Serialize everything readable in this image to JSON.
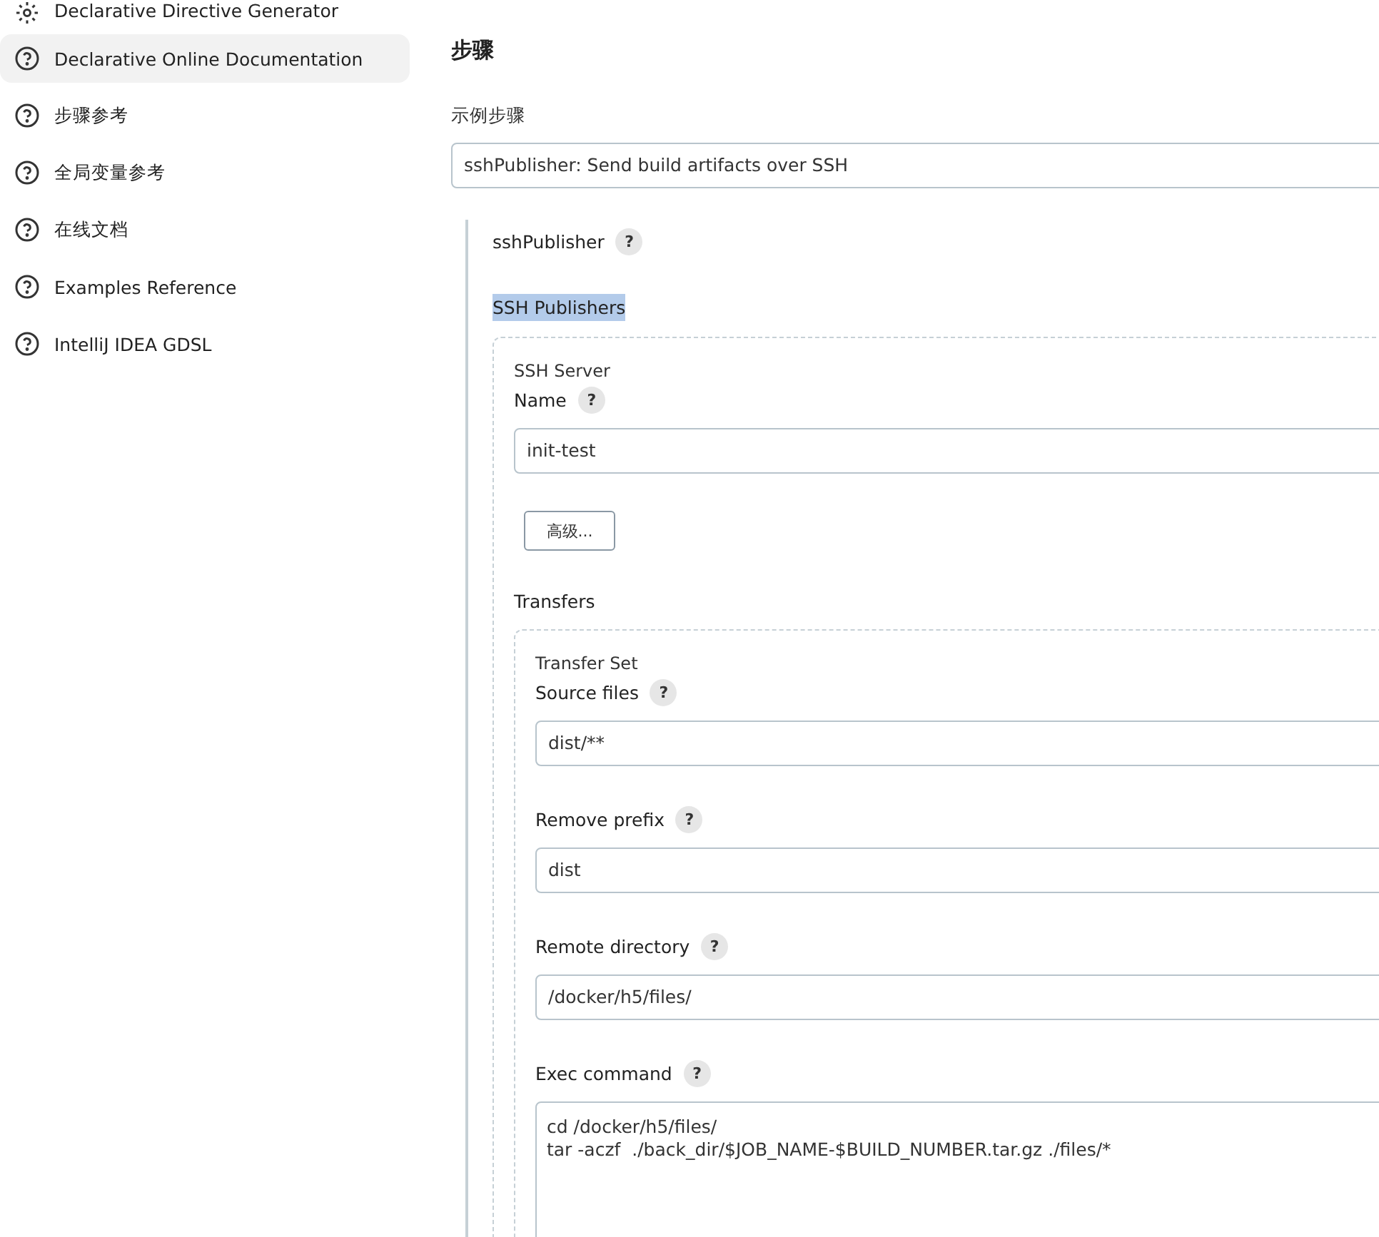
{
  "sidebar": {
    "items": [
      {
        "label": "Declarative Directive Generator",
        "kind": "gear",
        "selected": false
      },
      {
        "label": "Declarative Online Documentation",
        "kind": "help",
        "selected": true
      },
      {
        "label": "步骤参考",
        "kind": "help",
        "selected": false
      },
      {
        "label": "全局变量参考",
        "kind": "help",
        "selected": false
      },
      {
        "label": "在线文档",
        "kind": "help",
        "selected": false
      },
      {
        "label": "Examples Reference",
        "kind": "help",
        "selected": false
      },
      {
        "label": "IntelliJ IDEA GDSL",
        "kind": "help",
        "selected": false
      }
    ]
  },
  "main": {
    "heading": "步骤",
    "sample_label": "示例步骤",
    "sample_value": "sshPublisher: Send build artifacts over SSH",
    "step": {
      "name": "sshPublisher",
      "help": "?",
      "section": {
        "title": "SSH Publishers",
        "highlighted": true,
        "server": {
          "caption": "SSH Server",
          "name_label": "Name",
          "help": "?",
          "name_value": "init-test",
          "advanced_button": "高级...",
          "transfers_label": "Transfers",
          "transfer_set": {
            "caption": "Transfer Set",
            "fields": [
              {
                "label": "Source files",
                "help": "?",
                "value": "dist/**",
                "kind": "input"
              },
              {
                "label": "Remove prefix",
                "help": "?",
                "value": "dist",
                "kind": "input"
              },
              {
                "label": "Remote directory",
                "help": "?",
                "value": "/docker/h5/files/",
                "kind": "input"
              },
              {
                "label": "Exec command",
                "help": "?",
                "value": "cd /docker/h5/files/\ntar -aczf  ./back_dir/$JOB_NAME-$BUILD_NUMBER.tar.gz ./files/*",
                "kind": "textarea"
              }
            ]
          }
        }
      }
    }
  }
}
